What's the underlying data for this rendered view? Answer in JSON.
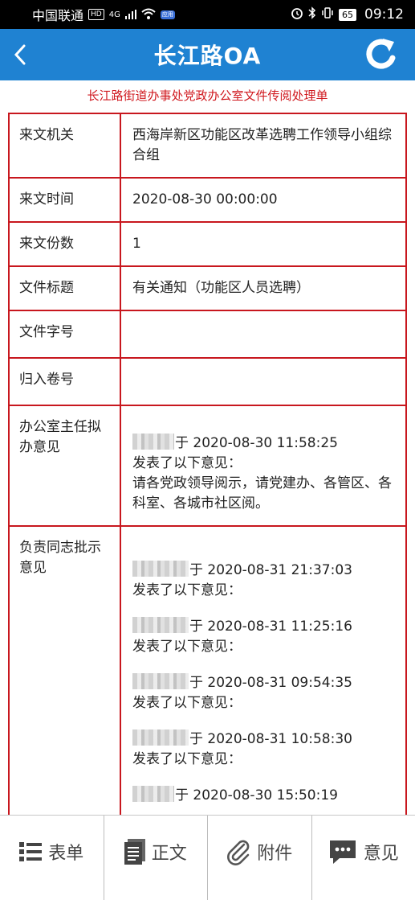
{
  "status_bar": {
    "carrier": "中国联通",
    "hd": "HD",
    "network": "4G",
    "app_badge": "应用",
    "battery": "65",
    "time": "09:12"
  },
  "header": {
    "title": "长江路OA"
  },
  "form": {
    "title": "长江路街道办事处党政办公室文件传阅处理单",
    "rows": [
      {
        "label": "来文机关",
        "value": "西海岸新区功能区改革选聘工作领导小组综合组"
      },
      {
        "label": "来文时间",
        "value": "2020-08-30 00:00:00"
      },
      {
        "label": "来文份数",
        "value": "1"
      },
      {
        "label": "文件标题",
        "value": "有关通知（功能区人员选聘）"
      },
      {
        "label": "文件字号",
        "value": ""
      },
      {
        "label": "归入卷号",
        "value": ""
      }
    ],
    "office_opinion": {
      "label": "办公室主任拟办意见",
      "time": "于 2020-08-30 11:58:25",
      "prefix": "发表了以下意见：",
      "text": "请各党政领导阅示，请党建办、各管区、各科室、各城市社区阅。"
    },
    "leader_opinion": {
      "label": "负责同志批示意见",
      "entries": [
        {
          "time": "于 2020-08-31 21:37:03",
          "prefix": "发表了以下意见："
        },
        {
          "time": "于 2020-08-31 11:25:16",
          "prefix": "发表了以下意见："
        },
        {
          "time": "于 2020-08-31 09:54:35",
          "prefix": "发表了以下意见："
        },
        {
          "time": "于 2020-08-31 10:58:30",
          "prefix": "发表了以下意见："
        },
        {
          "time": "于 2020-08-30 15:50:19",
          "prefix": ""
        }
      ]
    }
  },
  "toolbar": {
    "form_label": "表单",
    "body_label": "正文",
    "attachment_label": "附件",
    "opinion_label": "意见"
  },
  "colors": {
    "header_blue": "#1f82d2",
    "border_red": "#c8171e",
    "title_red": "#d0191f"
  }
}
